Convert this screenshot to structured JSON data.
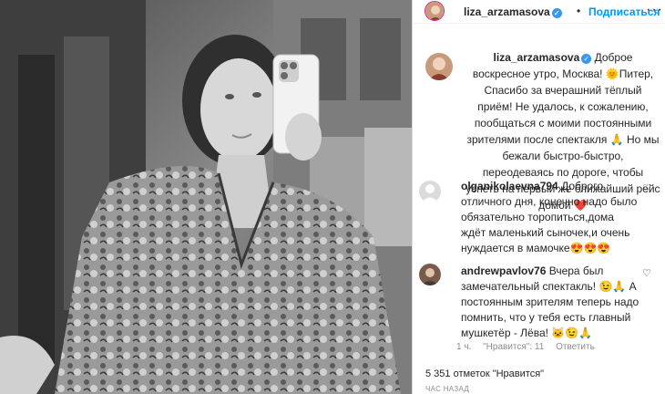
{
  "post": {
    "username": "liza_arzamasova",
    "follow_label": "Подписаться",
    "separator": "•",
    "more_label": "···",
    "verified_mark": "✓",
    "caption_text": "Доброе воскресное утро, Москва! 🌞Питер, Спасибо за вчерашний тёплый приём! Не удалось, к сожалению, пообщаться с моими постоянными зрителями после спектакля 🙏 Но мы бежали быстро-быстро, переодеваясь по дороге, чтобы успеть на первый же ближайший рейс домой ❤️",
    "likes": "5 351 отметок \"Нравится\"",
    "time_ago": "ЧАС НАЗАД"
  },
  "comments": [
    {
      "username": "olganikolaevna794",
      "text": "Доброго отличного дня, конечно надо было обязательно торопиться,дома ждёт маленький сыночек,и очень нуждается в мамочке😍😍😍",
      "heart_icon": "heart-outline-icon"
    },
    {
      "username": "andrewpavlov76",
      "text": "Вчера был замечательный спектакль! 😉🙏 А постоянным зрителям теперь надо помнить, что у тебя есть главный мушкетёр - Лёва! 🐱😉🙏",
      "heart_icon": "heart-outline-icon",
      "time": "1 ч.",
      "likes": "\"Нравится\": 11",
      "reply_label": "Ответить"
    }
  ],
  "colors": {
    "accent": "#0095f6",
    "verified": "#3897f0",
    "text": "#262626",
    "muted": "#8e8e8e",
    "border": "#dbdbdb"
  }
}
